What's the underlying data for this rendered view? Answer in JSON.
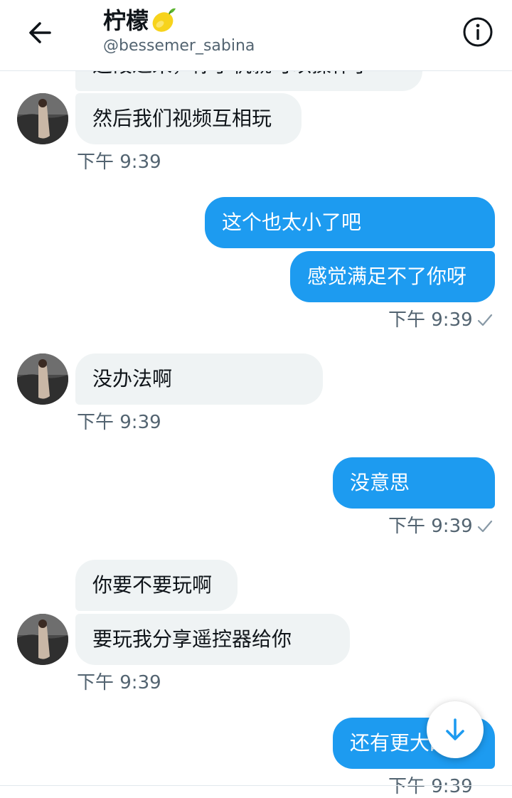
{
  "header": {
    "title": "柠檬",
    "handle": "@bessemer_sabina"
  },
  "icons": {
    "back": "arrow-left-icon",
    "lemon": "lemon-emoji-icon",
    "info": "info-circle-icon",
    "check": "check-icon",
    "scroll_down": "arrow-down-icon"
  },
  "colors": {
    "accent": "#1d9bf0",
    "incoming_bubble": "#eff3f4",
    "secondary_text": "#536471"
  },
  "messages": {
    "m0": {
      "text": "这段过来，你手机就可以操作了"
    },
    "m1": {
      "text": "然后我们视频互相玩",
      "time": "下午 9:39"
    },
    "m2": {
      "text": "这个也太小了吧"
    },
    "m3": {
      "text": "感觉满足不了你呀",
      "time": "下午 9:39"
    },
    "m4": {
      "text": "没办法啊",
      "time": "下午 9:39"
    },
    "m5": {
      "text": "没意思",
      "time": "下午 9:39"
    },
    "m6": {
      "text": "你要不要玩啊"
    },
    "m7": {
      "text": "要玩我分享遥控器给你",
      "time": "下午 9:39"
    },
    "m8": {
      "text": "还有更大的",
      "time": "下午 9:39"
    }
  }
}
